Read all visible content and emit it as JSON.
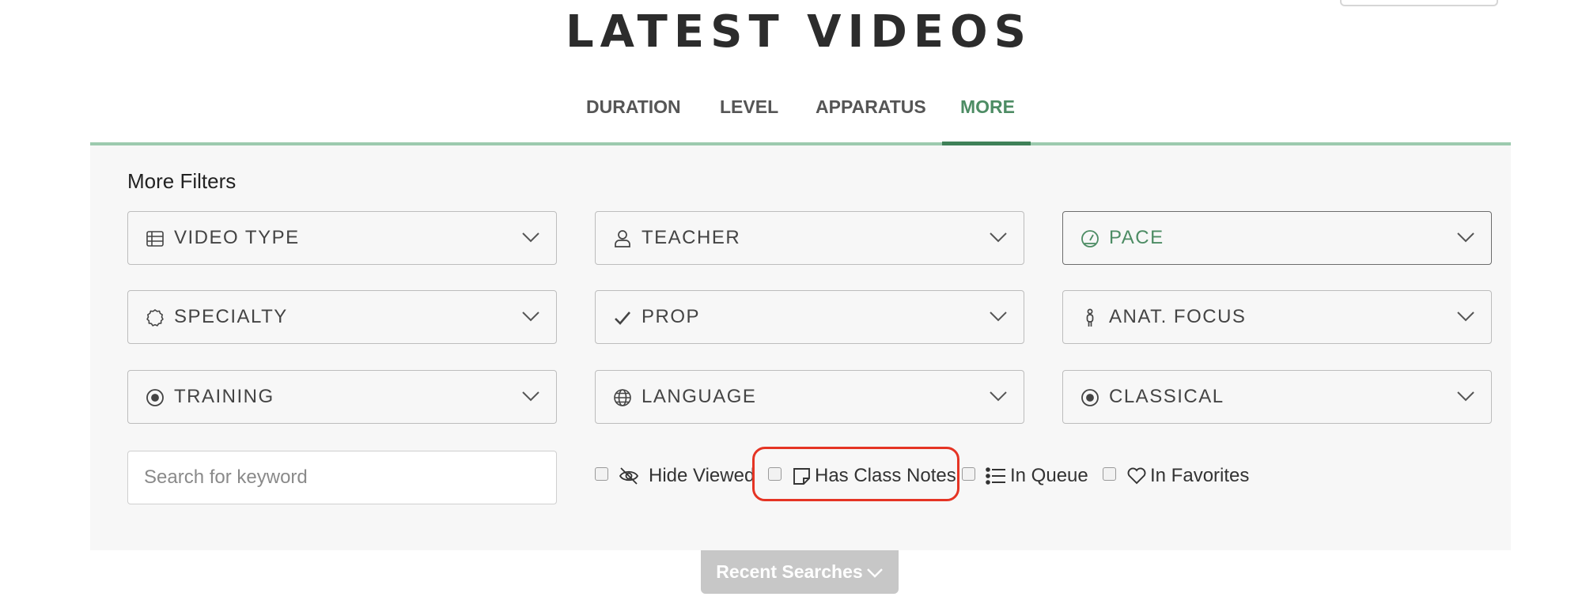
{
  "page": {
    "title": "LATEST VIDEOS"
  },
  "tabs": [
    {
      "label": "DURATION"
    },
    {
      "label": "LEVEL"
    },
    {
      "label": "APPARATUS"
    },
    {
      "label": "MORE",
      "active": true
    }
  ],
  "filters": {
    "title": "More Filters",
    "dropdowns": [
      {
        "label": "VIDEO TYPE",
        "icon": "table-icon"
      },
      {
        "label": "TEACHER",
        "icon": "person-icon"
      },
      {
        "label": "PACE",
        "icon": "gauge-icon",
        "active": true
      },
      {
        "label": "SPECIALTY",
        "icon": "badge-icon"
      },
      {
        "label": "PROP",
        "icon": "checkmark-icon"
      },
      {
        "label": "ANAT. FOCUS",
        "icon": "body-icon"
      },
      {
        "label": "TRAINING",
        "icon": "target-icon"
      },
      {
        "label": "LANGUAGE",
        "icon": "globe-icon"
      },
      {
        "label": "CLASSICAL",
        "icon": "target-icon"
      }
    ],
    "search_placeholder": "Search for keyword",
    "options": [
      {
        "label": "Hide Viewed",
        "icon": "eye-slash-icon",
        "checked": false
      },
      {
        "label": "Has Class Notes",
        "icon": "note-icon",
        "checked": false,
        "highlighted": true
      },
      {
        "label": "In Queue",
        "icon": "list-icon",
        "checked": false
      },
      {
        "label": "In Favorites",
        "icon": "heart-icon",
        "checked": false
      }
    ]
  },
  "recent_searches": {
    "label": "Recent Searches"
  },
  "colors": {
    "accent": "#4d8c64",
    "tab_line": "#9ccaae",
    "highlight": "#e53424",
    "panel_bg": "#f7f7f7"
  }
}
